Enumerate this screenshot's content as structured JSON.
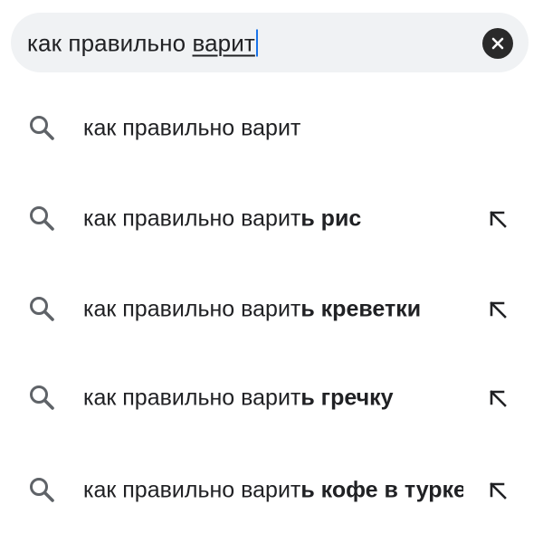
{
  "search": {
    "query_base": "как правильно ",
    "query_composing": "варит"
  },
  "suggestions": [
    {
      "typed": "как правильно варит",
      "completion": "",
      "icon": "search-icon",
      "fill_icon": ""
    },
    {
      "typed": "как правильно варит",
      "completion": "ь рис",
      "icon": "search-icon",
      "fill_icon": "arrow-up-left-icon"
    },
    {
      "typed": "как правильно варит",
      "completion": "ь креветки",
      "icon": "search-icon",
      "fill_icon": "arrow-up-left-icon"
    },
    {
      "typed": "как правильно варит",
      "completion": "ь гречку",
      "icon": "search-icon",
      "fill_icon": "arrow-up-left-icon"
    },
    {
      "typed": "как правильно варит",
      "completion": "ь кофе в турке",
      "icon": "search-icon",
      "fill_icon": "arrow-up-left-icon"
    }
  ],
  "colors": {
    "search_bar_bg": "#f0f2f4",
    "caret": "#1a73e8",
    "icon_gray": "#5f6368",
    "text": "#202124"
  }
}
